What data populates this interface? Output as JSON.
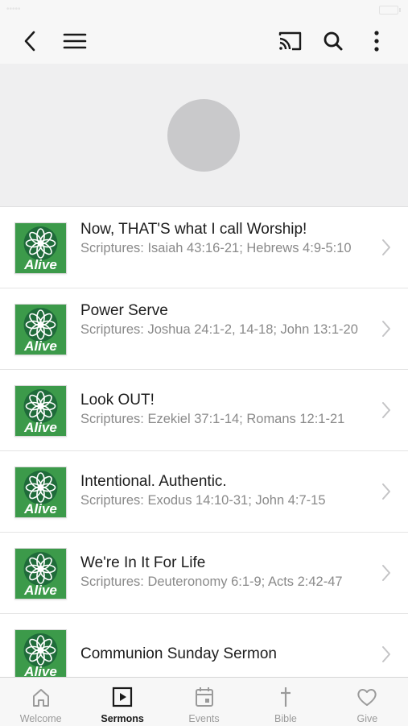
{
  "status_bar": {
    "carrier": "•••••  ",
    "time": ""
  },
  "toolbar": {
    "back_icon": "chevron-left-icon",
    "menu_icon": "hamburger-icon",
    "cast_icon": "cast-icon",
    "search_icon": "search-icon",
    "more_icon": "vertical-dots-icon"
  },
  "sermons": [
    {
      "title": "Now, THAT'S what I call Worship!",
      "scriptures": "Scriptures:  Isaiah 43:16-21; Hebrews 4:9-5:10"
    },
    {
      "title": "Power Serve",
      "scriptures": "Scriptures:  Joshua 24:1-2, 14-18; John 13:1-20"
    },
    {
      "title": "Look OUT!",
      "scriptures": "Scriptures:  Ezekiel 37:1-14; Romans 12:1-21"
    },
    {
      "title": "Intentional.  Authentic.",
      "scriptures": "Scriptures: Exodus 14:10-31; John 4:7-15"
    },
    {
      "title": "We're In It For Life",
      "scriptures": "Scriptures: Deuteronomy 6:1-9; Acts 2:42-47"
    },
    {
      "title": "Communion Sunday Sermon",
      "scriptures": ""
    }
  ],
  "thumbnail_label": "Alive",
  "colors": {
    "brand_green": "#3c9a4a",
    "dark_green": "#1f6b3a",
    "active_tab": "#1a1a1a",
    "inactive_tab": "#9a9a9a"
  },
  "tabs": [
    {
      "label": "Welcome",
      "icon": "home-icon"
    },
    {
      "label": "Sermons",
      "icon": "play-icon",
      "active": true
    },
    {
      "label": "Events",
      "icon": "calendar-icon"
    },
    {
      "label": "Bible",
      "icon": "cross-icon"
    },
    {
      "label": "Give",
      "icon": "heart-icon"
    }
  ]
}
